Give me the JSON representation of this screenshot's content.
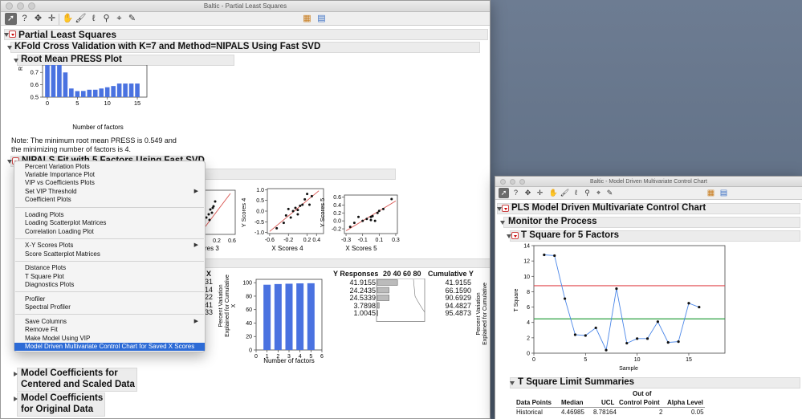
{
  "main_window": {
    "title": "Baltic - Partial Least Squares",
    "report_title": "Partial Least Squares",
    "kfold_title": "KFold Cross Validation with K=7 and Method=NIPALS Using Fast SVD",
    "press_title": "Root Mean PRESS Plot",
    "press_axis_label_partial": "R",
    "press_xlabel": "Number of factors",
    "note_line1": "Note: The minimum root mean PRESS is 0.549 and",
    "note_line2": "the minimizing number of factors is 4.",
    "nipals_title": "NIPALS Fit with 5 Factors Using Fast SVD",
    "scores": {
      "plot4_ylabel": "Y Scores 4",
      "plot4_xlabel": "X Scores 4",
      "plot5_ylabel": "Y Scores 5",
      "plot5_xlabel": "X Scores 5",
      "plot3_xlabel_partial": "Scores 3"
    },
    "variation": {
      "x_col_partial": "X",
      "x_values_partial": [
        "31",
        "14",
        "22",
        "41",
        "33"
      ],
      "ylabel_line1": "Percent Variation",
      "ylabel_line2": "Explained for Cumulative",
      "ylabel_line3": "X",
      "xlabel": "Number of factors",
      "y_responses_header": "Y Responses",
      "bar_header": "20 40 60 80",
      "cumulative_y_header": "Cumulative Y",
      "y_responses": [
        "41.9155",
        "24.2435",
        "24.5339",
        "3.7898",
        "1.0045"
      ],
      "cumulative_y": [
        "41.9155",
        "66.1590",
        "90.6929",
        "94.4827",
        "95.4873"
      ],
      "right_ylabel_line1": "Percent Variation",
      "right_ylabel_line2": "Explained for Cumulative"
    },
    "coef_centered_line1": "Model Coefficients for",
    "coef_centered_line2": "Centered and Scaled Data",
    "coef_original_line1": "Model Coefficients",
    "coef_original_line2": "for Original Data"
  },
  "context_menu": {
    "items": [
      "Percent Variation Plots",
      "Variable Importance Plot",
      "VIP vs Coefficients Plots",
      "Set VIP Threshold",
      "Coefficient Plots",
      "Loading Plots",
      "Loading Scatterplot Matrices",
      "Correlation Loading Plot",
      "X-Y Scores Plots",
      "Score Scatterplot Matrices",
      "Distance Plots",
      "T Square Plot",
      "Diagnostics Plots",
      "Profiler",
      "Spectral Profiler",
      "Save Columns",
      "Remove Fit",
      "Make Model Using VIP",
      "Model Driven Multivariate Control Chart for Saved X Scores"
    ]
  },
  "control_window": {
    "title": "Baltic - Model Driven Multivariate Control Chart",
    "report_title": "PLS Model Driven Multivariate Control Chart",
    "monitor_title": "Monitor the Process",
    "tsq_title": "T Square for 5 Factors",
    "tsq_ylabel": "T Square",
    "tsq_xlabel": "Sample",
    "limit_title": "T Square Limit Summaries",
    "table": {
      "headers": [
        "Data Points",
        "Median",
        "UCL",
        "Out of Control Point",
        "Alpha Level"
      ],
      "header_out_line1": "Out of",
      "header_out_line2": "Control Point",
      "row": [
        "Historical",
        "4.46985",
        "8.78164",
        "2",
        "0.05"
      ]
    },
    "colors": {
      "ucl": "#e0474c",
      "median": "#2ea043",
      "series": "#4a86e8"
    }
  },
  "chart_data": [
    {
      "type": "bar",
      "title": "Root Mean PRESS Plot",
      "xlabel": "Number of factors",
      "ylabel": "",
      "x": [
        0,
        1,
        2,
        3,
        4,
        5,
        6,
        7,
        8,
        9,
        10,
        11,
        12,
        13,
        14,
        15
      ],
      "values": [
        0.95,
        0.93,
        0.85,
        0.7,
        0.57,
        0.549,
        0.55,
        0.56,
        0.56,
        0.57,
        0.58,
        0.59,
        0.61,
        0.61,
        0.61,
        0.61
      ],
      "ylim": [
        0.5,
        0.76
      ],
      "xticks": [
        0,
        5,
        10,
        15
      ],
      "yticks": [
        0.5,
        0.6,
        0.7
      ]
    },
    {
      "type": "scatter",
      "xlabel": "X Scores 4",
      "ylabel": "Y Scores 4",
      "xlim": [
        -0.65,
        0.55
      ],
      "ylim": [
        -1.05,
        1.05
      ],
      "xticks": [
        -0.6,
        -0.2,
        0.2,
        0.4
      ],
      "yticks": [
        -1.0,
        -0.5,
        0.0,
        0.5,
        1.0
      ],
      "points": [
        [
          -0.45,
          -0.8
        ],
        [
          -0.3,
          -0.55
        ],
        [
          -0.25,
          -0.2
        ],
        [
          -0.2,
          0.1
        ],
        [
          -0.15,
          -0.3
        ],
        [
          -0.1,
          0.0
        ],
        [
          -0.05,
          0.15
        ],
        [
          0.0,
          0.05
        ],
        [
          0.0,
          -0.15
        ],
        [
          0.05,
          0.25
        ],
        [
          0.1,
          0.3
        ],
        [
          0.15,
          0.55
        ],
        [
          0.2,
          0.8
        ],
        [
          0.25,
          0.3
        ],
        [
          0.3,
          0.7
        ]
      ],
      "fit": [
        [
          -0.6,
          -0.95
        ],
        [
          0.45,
          0.95
        ]
      ]
    },
    {
      "type": "scatter",
      "xlabel": "X Scores 5",
      "ylabel": "Y Scores 5",
      "xlim": [
        -0.32,
        0.32
      ],
      "ylim": [
        -0.32,
        0.65
      ],
      "xticks": [
        -0.3,
        -0.1,
        0.1,
        0.3
      ],
      "yticks": [
        -0.2,
        0.0,
        0.2,
        0.4,
        0.6
      ],
      "points": [
        [
          -0.25,
          -0.15
        ],
        [
          -0.2,
          -0.05
        ],
        [
          -0.15,
          0.1
        ],
        [
          -0.1,
          0.0
        ],
        [
          -0.05,
          0.05
        ],
        [
          0.0,
          0.02
        ],
        [
          0.0,
          0.1
        ],
        [
          0.02,
          0.12
        ],
        [
          0.05,
          0.0
        ],
        [
          0.08,
          0.2
        ],
        [
          0.1,
          0.25
        ],
        [
          0.15,
          0.3
        ],
        [
          0.25,
          0.55
        ]
      ],
      "fit": [
        [
          -0.3,
          -0.25
        ],
        [
          0.3,
          0.5
        ]
      ]
    },
    {
      "type": "bar",
      "xlabel": "Number of factors",
      "ylabel": "Percent Variation Explained for Cumulative X",
      "x": [
        1,
        2,
        3,
        4,
        5
      ],
      "values": [
        97,
        98,
        98.5,
        99,
        99.2
      ],
      "ylim": [
        0,
        105
      ],
      "xticks": [
        0,
        1,
        2,
        3,
        4,
        5,
        6
      ],
      "yticks": [
        0,
        20,
        40,
        60,
        80,
        100
      ]
    },
    {
      "type": "bar",
      "title": "Y Responses",
      "categories": [
        "1",
        "2",
        "3",
        "4",
        "5"
      ],
      "values": [
        41.9155,
        24.2435,
        24.5339,
        3.7898,
        1.0045
      ],
      "xticks": [
        20,
        40,
        60,
        80
      ]
    },
    {
      "type": "line",
      "title": "T Square for 5 Factors",
      "xlabel": "Sample",
      "ylabel": "T Square",
      "x": [
        1,
        2,
        3,
        4,
        5,
        6,
        7,
        8,
        9,
        10,
        11,
        12,
        13,
        14,
        15,
        16
      ],
      "values": [
        12.8,
        12.7,
        7.1,
        2.4,
        2.3,
        3.3,
        0.4,
        8.4,
        1.3,
        1.9,
        1.9,
        4.1,
        1.4,
        1.5,
        6.5,
        6.0
      ],
      "ucl": 8.78164,
      "median": 4.46985,
      "xlim": [
        0,
        18.5
      ],
      "ylim": [
        0,
        14
      ],
      "xticks": [
        0,
        5,
        10,
        15
      ],
      "yticks": [
        0,
        2,
        4,
        6,
        8,
        10,
        12,
        14
      ]
    }
  ]
}
